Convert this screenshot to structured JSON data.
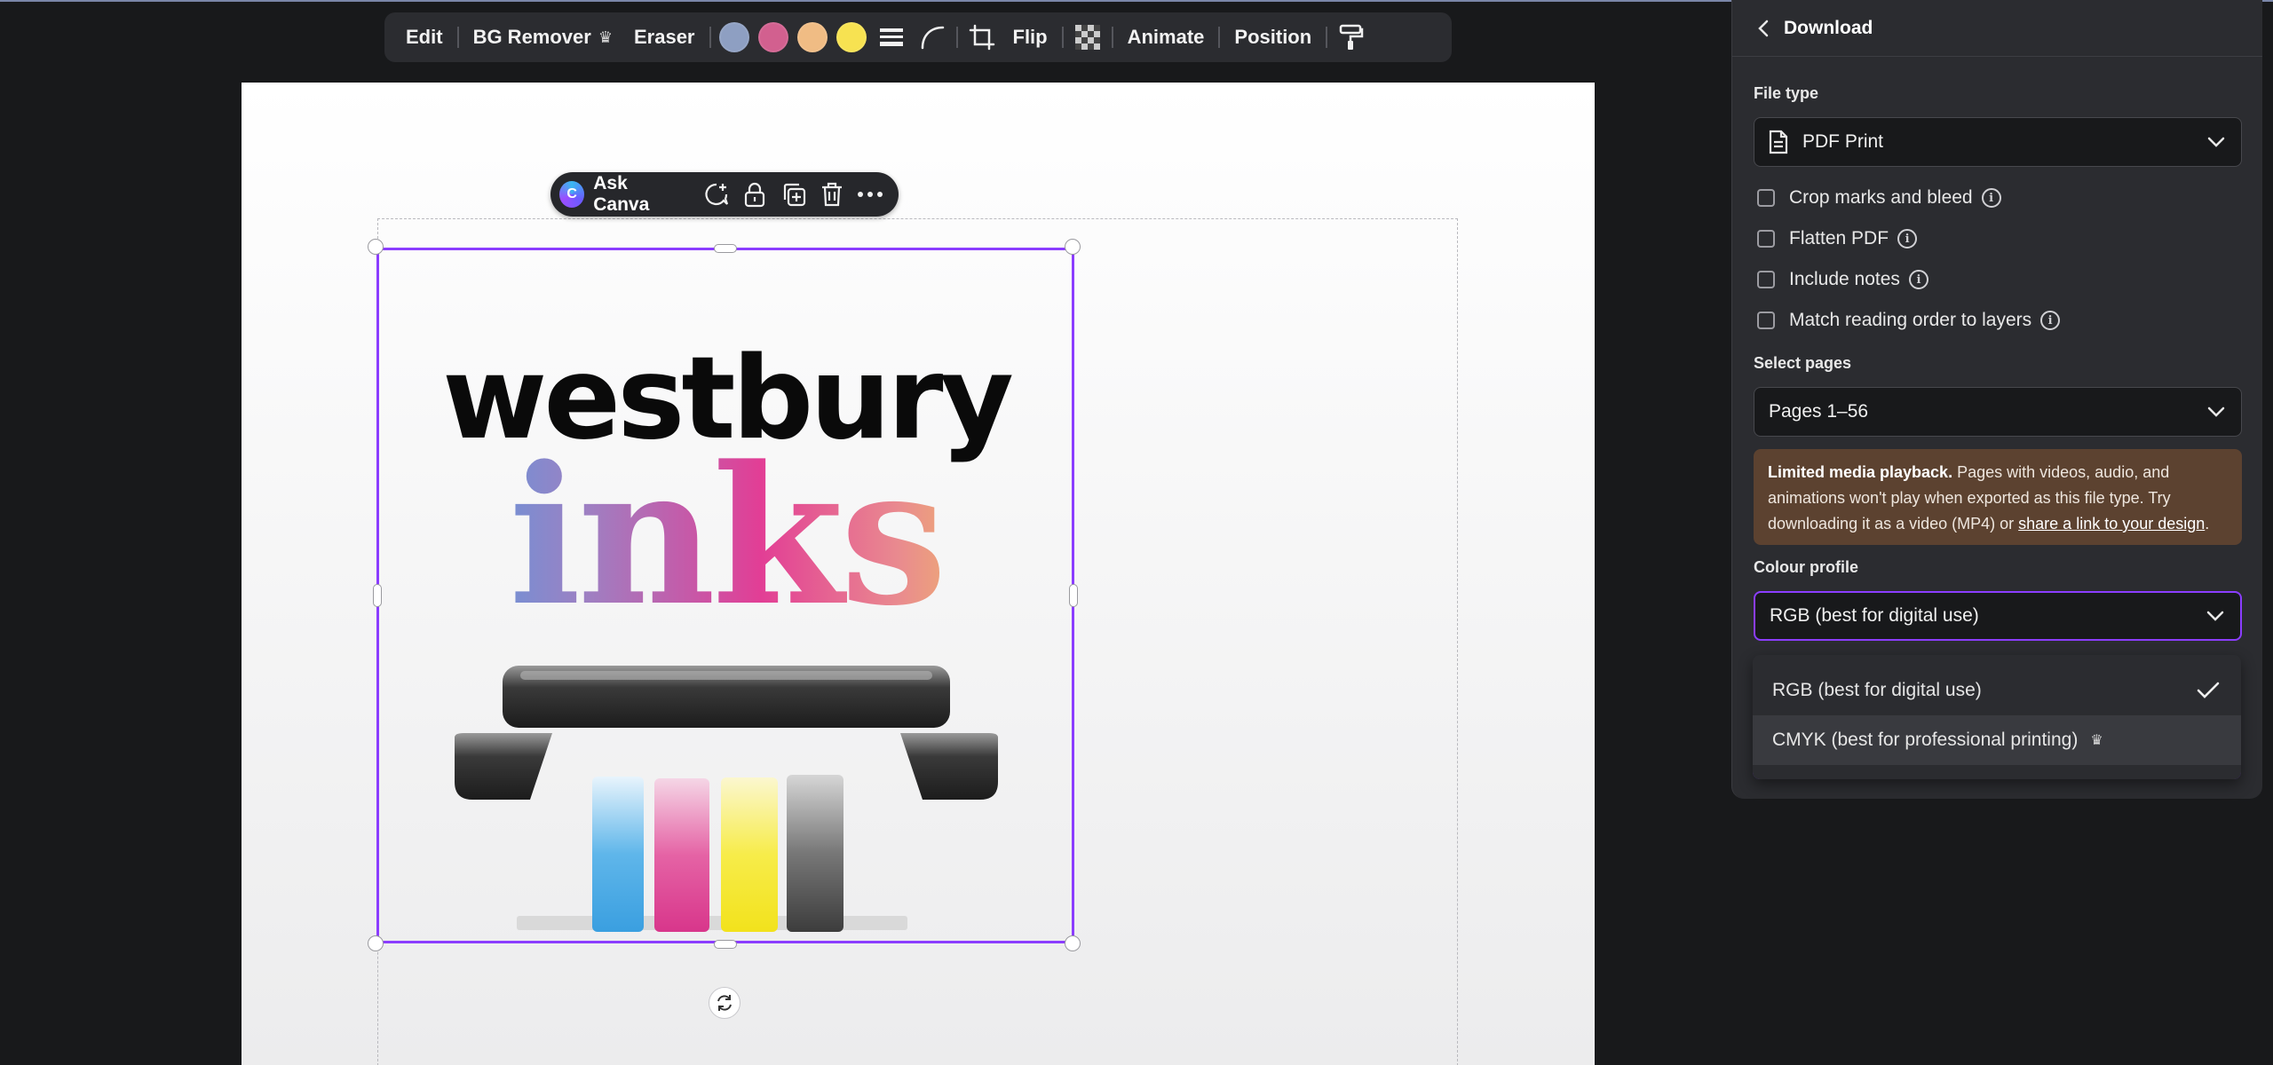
{
  "toolbar": {
    "edit": "Edit",
    "bg_remover": "BG Remover",
    "eraser": "Eraser",
    "colors": [
      "#8e9fc2",
      "#d2608f",
      "#f0bc84",
      "#f7e251"
    ],
    "flip": "Flip",
    "animate": "Animate",
    "position": "Position"
  },
  "canvas": {
    "pill": {
      "ask_canva": "Ask Canva"
    },
    "logo": {
      "line1": "westbury",
      "line2": "inks"
    }
  },
  "download_panel": {
    "title": "Download",
    "file_type_label": "File type",
    "file_type_value": "PDF Print",
    "options": [
      {
        "label": "Crop marks and bleed",
        "checked": false
      },
      {
        "label": "Flatten PDF",
        "checked": false
      },
      {
        "label": "Include notes",
        "checked": false
      },
      {
        "label": "Match reading order to layers",
        "checked": false
      }
    ],
    "select_pages_label": "Select pages",
    "select_pages_value": "Pages 1–56",
    "notice": {
      "bold": "Limited media playback.",
      "text": " Pages with videos, audio, and animations won't play when exported as this file type. Try downloading it as a video (MP4) or ",
      "link": "share a link to your design",
      "end": "."
    },
    "colour_profile_label": "Colour profile",
    "colour_profile_value": "RGB (best for digital use)",
    "colour_profile_options": [
      {
        "label": "RGB (best for digital use)",
        "selected": true
      },
      {
        "label": "CMYK (best for professional printing)",
        "selected": false,
        "premium": true
      }
    ]
  },
  "colors": {
    "accent": "#8b3dff",
    "panel": "#2b2c30",
    "background": "#18191b",
    "notice": "#5c4230"
  }
}
